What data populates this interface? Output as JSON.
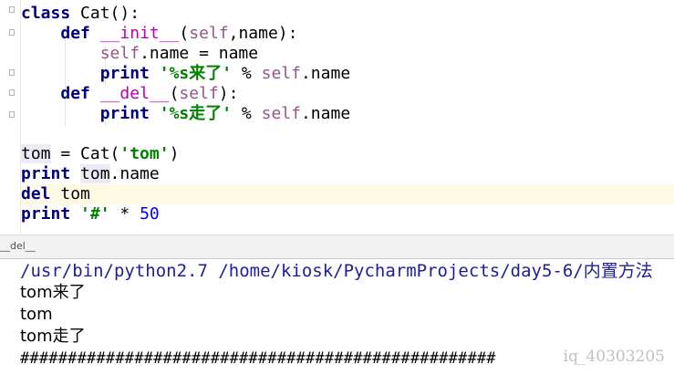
{
  "editor": {
    "lines": [
      {
        "t": [
          "class",
          " Cat():"
        ]
      },
      {
        "t": [
          "def",
          "__init__",
          "(",
          "self",
          ",name):"
        ]
      },
      {
        "t": [
          "self",
          ".name = name"
        ]
      },
      {
        "t": [
          "print",
          "'%s来了'",
          " % ",
          "self",
          ".name"
        ]
      },
      {
        "t": [
          "def",
          "__del__",
          "(",
          "self",
          "):"
        ]
      },
      {
        "t": [
          "print",
          "'%s走了'",
          " % ",
          "self",
          ".name"
        ]
      },
      {
        "t": [
          "tom",
          " = Cat(",
          "'tom'",
          ")"
        ]
      },
      {
        "t": [
          "print",
          "tom",
          ".name"
        ]
      },
      {
        "t": [
          "del",
          "tom"
        ]
      },
      {
        "t": [
          "print",
          "'#'",
          " * ",
          "50"
        ]
      }
    ]
  },
  "breadcrumb": {
    "label": "__del__"
  },
  "console": {
    "path": "/usr/bin/python2.7 /home/kiosk/PycharmProjects/day5-6/内置方法",
    "out1": "tom来了",
    "out2": "tom",
    "out3": "tom走了",
    "hashes": "##################################################"
  },
  "watermark": "iq_40303205"
}
